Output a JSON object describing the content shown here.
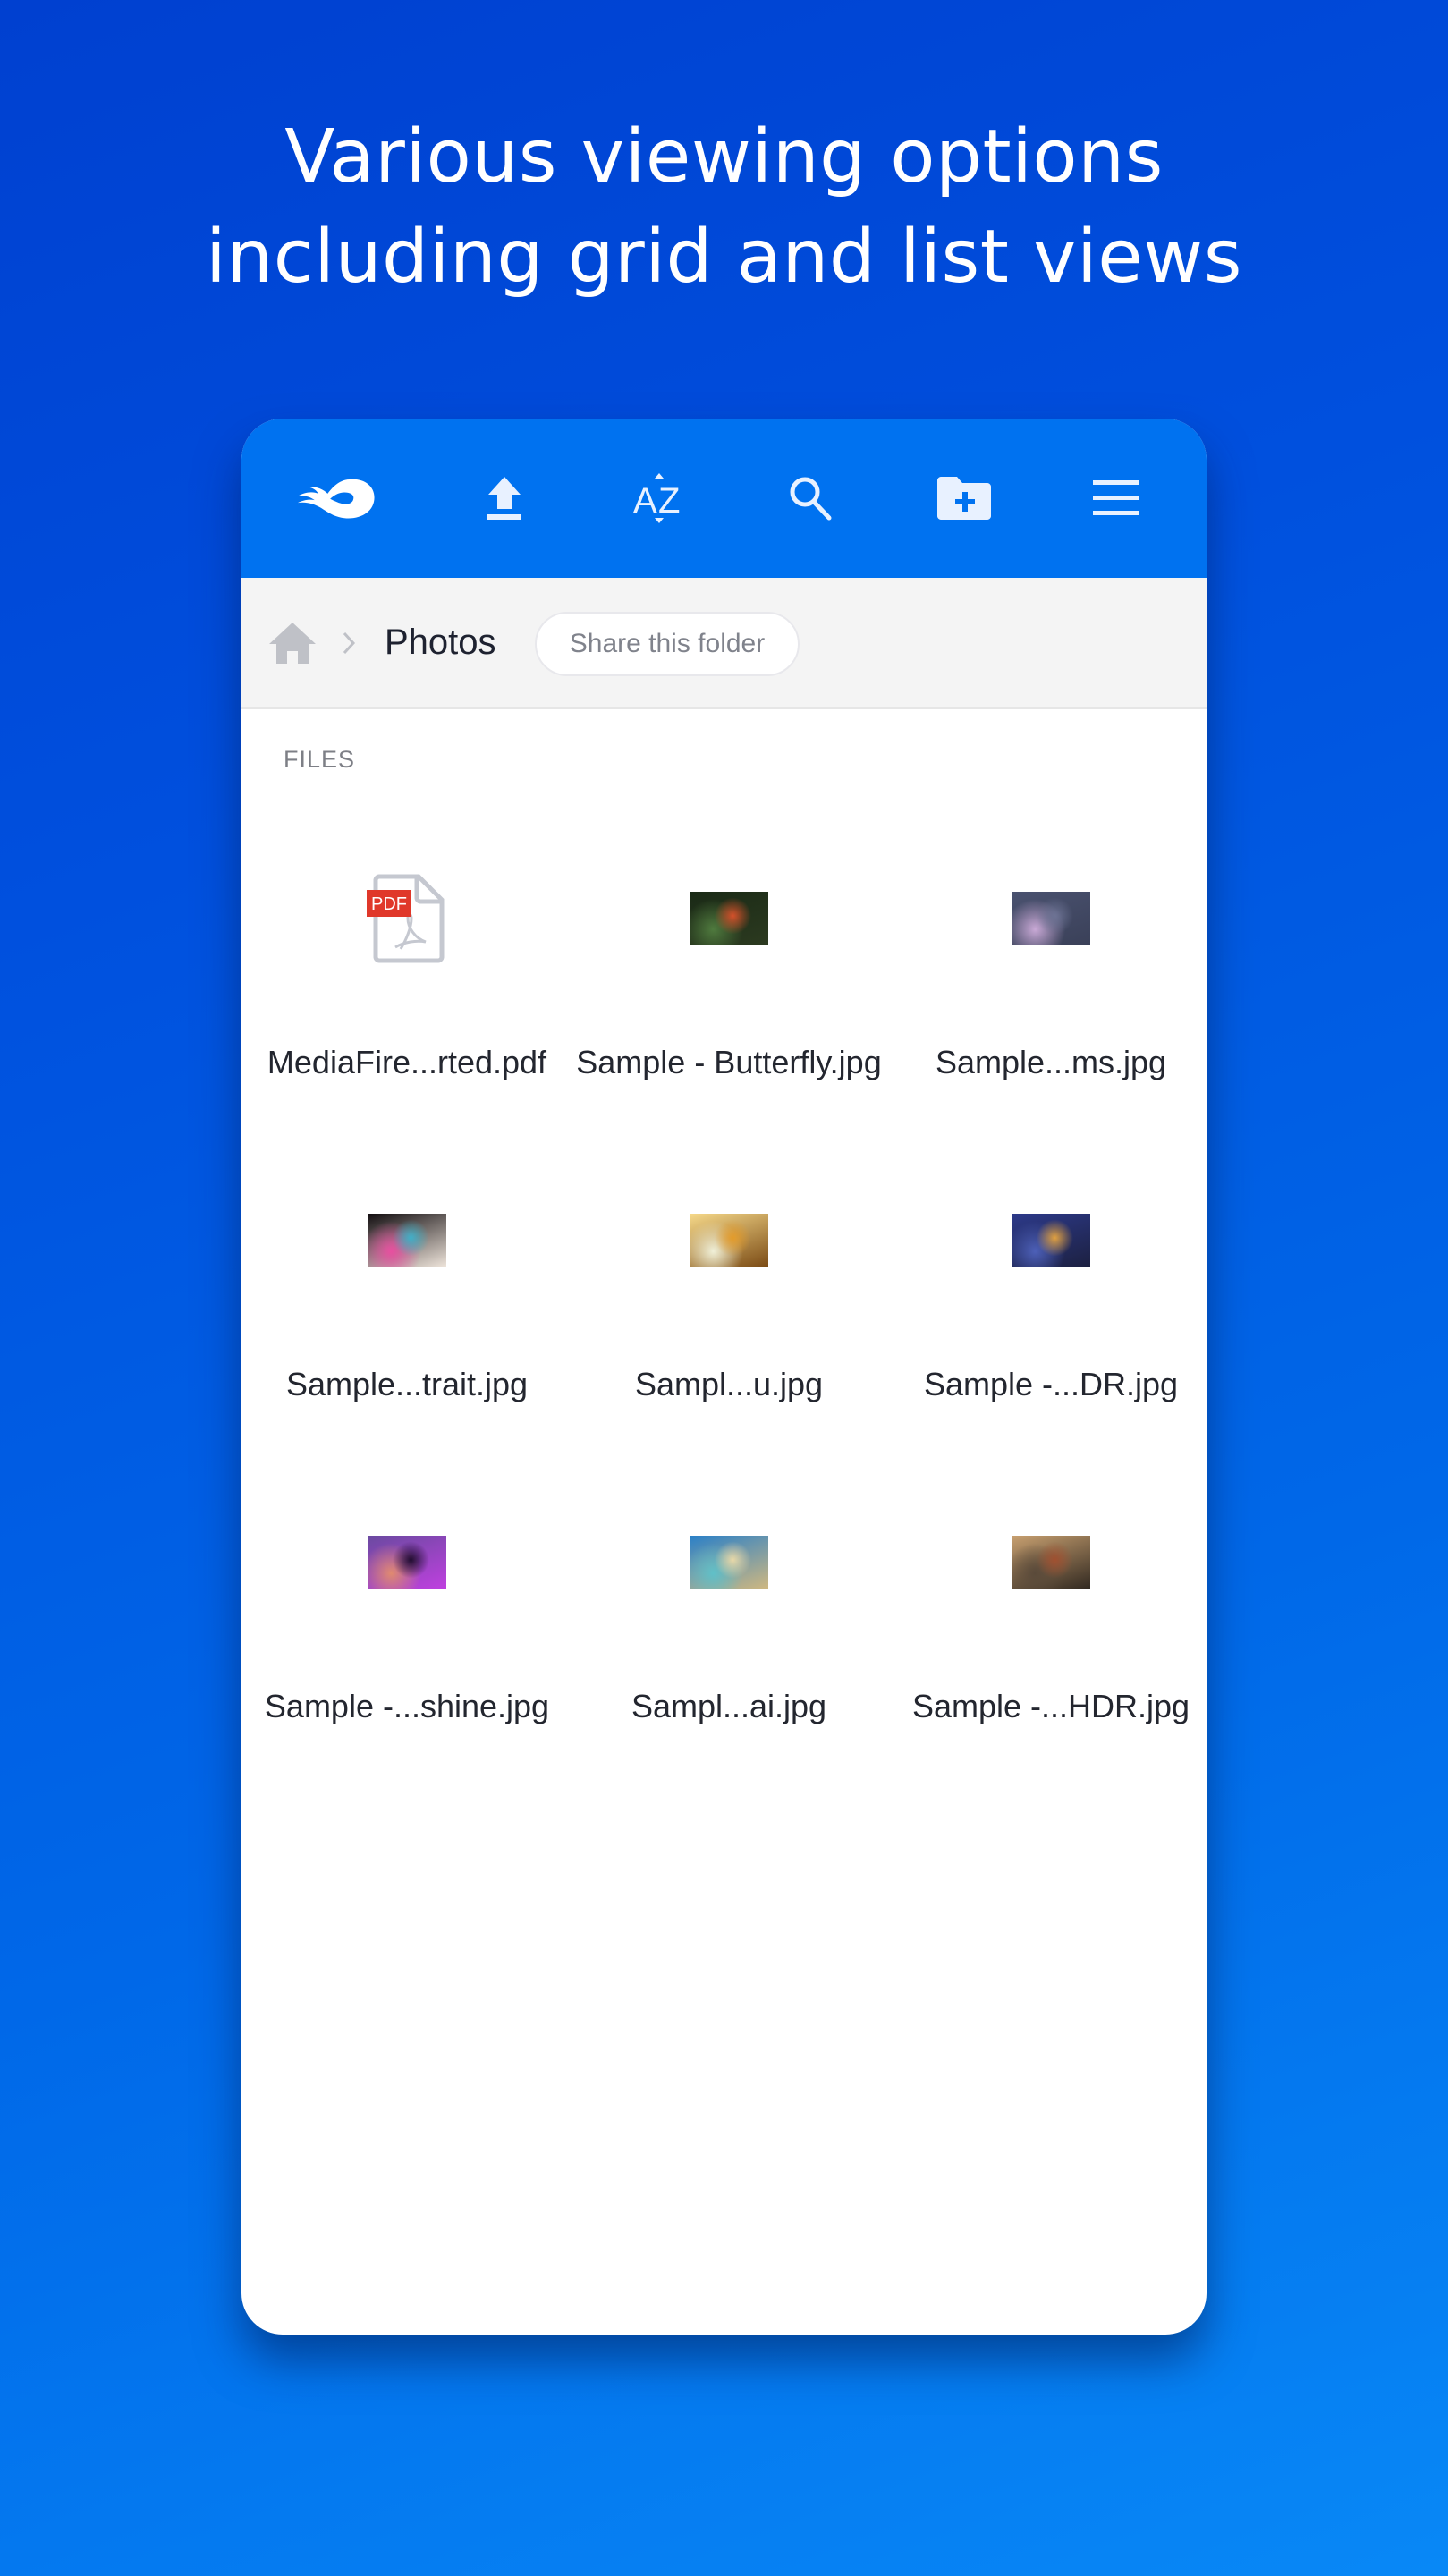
{
  "headline": {
    "line1": "Various viewing options",
    "line2": "including grid and list views"
  },
  "colors": {
    "header_blue": "#0072F0",
    "background_top": "#0040D0",
    "background_bottom": "#0888F6",
    "pdf_badge_red": "#E0382A"
  },
  "toolbar": {
    "items": [
      {
        "icon": "mediafire-logo-icon",
        "label": "MediaFire"
      },
      {
        "icon": "upload-icon",
        "label": "Upload"
      },
      {
        "icon": "sort-az-icon",
        "label": "Sort"
      },
      {
        "icon": "search-icon",
        "label": "Search"
      },
      {
        "icon": "new-folder-icon",
        "label": "New folder"
      },
      {
        "icon": "menu-icon",
        "label": "Menu"
      }
    ]
  },
  "breadcrumb": {
    "home_icon": "home-icon",
    "separator_icon": "chevron-right-icon",
    "current": "Photos",
    "share_label": "Share this folder"
  },
  "files": {
    "section_label": "FILES",
    "items": [
      {
        "name": "MediaFire...rted.pdf",
        "type": "pdf",
        "thumb_colors": []
      },
      {
        "name": "Sample - Butterfly.jpg",
        "type": "image",
        "thumb_colors": [
          "#1a2a16",
          "#4f7a3e",
          "#d4502a",
          "#2c3a20"
        ]
      },
      {
        "name": "Sample...ms.jpg",
        "type": "image",
        "thumb_colors": [
          "#4a5270",
          "#c9a9d6",
          "#6d7394",
          "#3a4058"
        ]
      },
      {
        "name": "Sample...trait.jpg",
        "type": "image",
        "thumb_colors": [
          "#120d10",
          "#e84fa0",
          "#3fb0c8",
          "#f0e6dc"
        ]
      },
      {
        "name": "Sampl...u.jpg",
        "type": "image",
        "thumb_colors": [
          "#f6d98a",
          "#f0f0d8",
          "#e39b2a",
          "#7a4a14"
        ]
      },
      {
        "name": "Sample -...DR.jpg",
        "type": "image",
        "thumb_colors": [
          "#2d3a8a",
          "#4d60b8",
          "#e0a040",
          "#1c2040"
        ]
      },
      {
        "name": "Sample -...shine.jpg",
        "type": "image",
        "thumb_colors": [
          "#6a4aa0",
          "#e08a70",
          "#200c30",
          "#c040e0"
        ]
      },
      {
        "name": "Sampl...ai.jpg",
        "type": "image",
        "thumb_colors": [
          "#2a80c8",
          "#60c0c8",
          "#e8d8a8",
          "#d0b880"
        ]
      },
      {
        "name": "Sample -...HDR.jpg",
        "type": "image",
        "thumb_colors": [
          "#c8a070",
          "#5a4a3a",
          "#a05030",
          "#302820"
        ]
      }
    ]
  }
}
